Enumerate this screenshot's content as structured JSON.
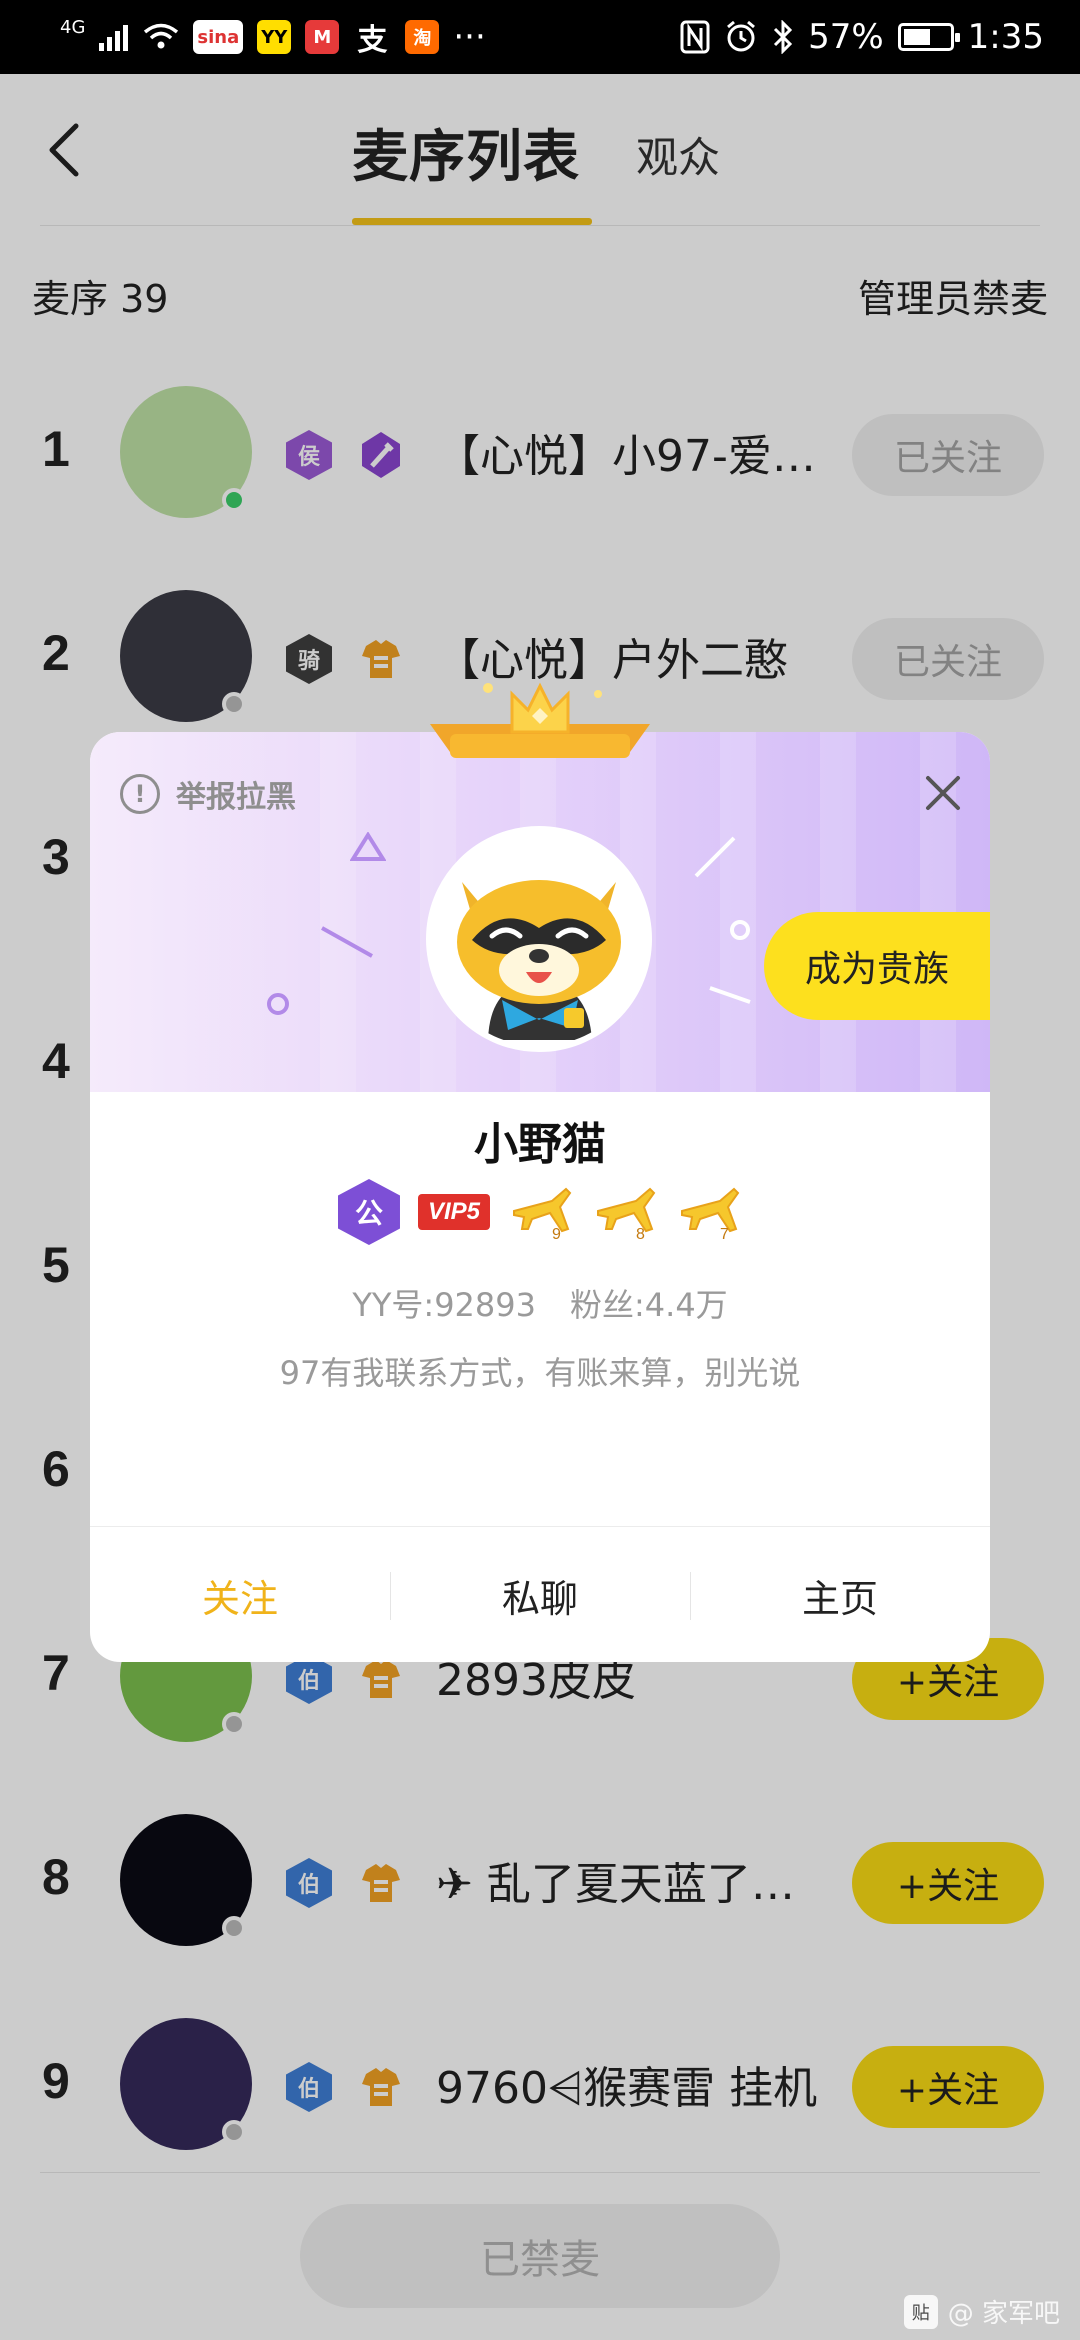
{
  "status_bar": {
    "network": "4G",
    "apps": [
      "sina",
      "YY",
      "M",
      "支",
      "淘"
    ],
    "more": "···",
    "battery": "57%",
    "time": "1:35"
  },
  "header": {
    "active_tab": "麦序列表",
    "other_tab": "观众"
  },
  "subheader": {
    "queue_label": "麦序  39",
    "admin_action": "管理员禁麦"
  },
  "queue": [
    {
      "rank": "1",
      "badge": "侯",
      "badge_color": "#9b5bd6",
      "badge2": "sword",
      "name": "【心悦】小97-爱笑...",
      "follow": "已关注",
      "following": true,
      "online": true,
      "avatar_color": "#bfe1a6"
    },
    {
      "rank": "2",
      "badge": "骑",
      "badge_color": "#3f3f3f",
      "badge2": "shirt",
      "name": "【心悦】户外二憨",
      "follow": "已关注",
      "following": true,
      "online": false,
      "avatar_color": "#3b3b45"
    },
    {
      "rank": "3",
      "badge": "",
      "badge_color": "#3f7fd6",
      "badge2": "shirt",
      "name": "",
      "follow": "",
      "following": true,
      "online": false,
      "avatar_color": "#cccccc"
    },
    {
      "rank": "4",
      "badge": "",
      "badge_color": "#3f7fd6",
      "badge2": "shirt",
      "name": "",
      "follow": "",
      "following": false,
      "online": false,
      "avatar_color": "#cccccc"
    },
    {
      "rank": "5",
      "badge": "",
      "badge_color": "#3f7fd6",
      "badge2": "shirt",
      "name": "",
      "follow": "",
      "following": false,
      "online": false,
      "avatar_color": "#cccccc"
    },
    {
      "rank": "6",
      "badge": "",
      "badge_color": "#3f7fd6",
      "badge2": "shirt",
      "name": "",
      "follow": "",
      "following": false,
      "online": false,
      "avatar_color": "#cccccc"
    },
    {
      "rank": "7",
      "badge": "伯",
      "badge_color": "#3f7fd6",
      "badge2": "shirt",
      "name": "2893皮皮",
      "follow": "+关注",
      "following": false,
      "online": false,
      "avatar_color": "#7cc04e"
    },
    {
      "rank": "8",
      "badge": "伯",
      "badge_color": "#3f7fd6",
      "badge2": "shirt",
      "name": "✈ 乱了夏天蓝了海...",
      "follow": "+关注",
      "following": false,
      "online": false,
      "avatar_color": "#0b0b14"
    },
    {
      "rank": "9",
      "badge": "伯",
      "badge_color": "#3f7fd6",
      "badge2": "shirt",
      "name": "9760⩤猴赛雷  挂机",
      "follow": "+关注",
      "following": false,
      "online": false,
      "avatar_color": "#352a5a"
    }
  ],
  "bottom": {
    "mute_button": "已禁麦"
  },
  "watermark": {
    "icon": "贴",
    "text": "@ 家军吧"
  },
  "popup": {
    "report": "举报拉黑",
    "noble_button": "成为贵族",
    "username": "小野猫",
    "gong_badge": "公",
    "vip_badge": "VIP5",
    "plane_levels": [
      "9",
      "8",
      "7"
    ],
    "yy_number": "YY号:92893",
    "fans": "粉丝:4.4万",
    "signature": "97有我联系方式，有账来算，别光说",
    "actions": [
      "关注",
      "私聊",
      "主页"
    ],
    "accent": "#f0b31a"
  }
}
